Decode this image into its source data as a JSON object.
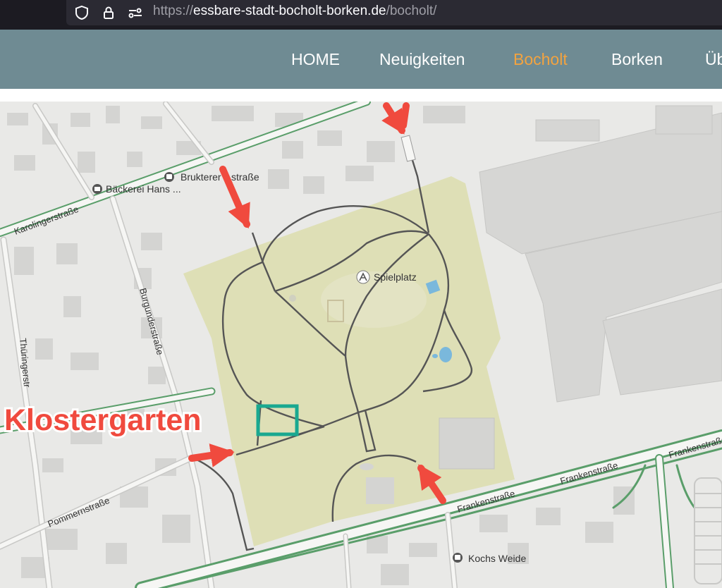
{
  "browser": {
    "url_prefix": "https://",
    "url_domain": "essbare-stadt-bocholt-borken.de",
    "url_path": "/bocholt/",
    "icons": [
      "shield-icon",
      "lock-icon",
      "permissions-icon"
    ]
  },
  "nav": {
    "items": [
      {
        "label": "HOME",
        "active": false
      },
      {
        "label": "Neuigkeiten",
        "active": false
      },
      {
        "label": "Bocholt",
        "active": true
      },
      {
        "label": "Borken",
        "active": false
      },
      {
        "label": "Üb",
        "active": false
      }
    ],
    "background": "#6f8b93",
    "active_color": "#f2a340"
  },
  "map": {
    "streets": {
      "karolingerstrasse": "Karolingerstraße",
      "brukterer": "Brukterer",
      "brukterer_suffix": "straße",
      "burgunderstrasse": "Burgunderstraße",
      "thueringer": "Thüringerstr",
      "pommernstrasse": "Pommernstraße",
      "frankenstrasse": "Frankenstraße"
    },
    "pois": {
      "baeckerei": "Bäckerei Hans ...",
      "spielplatz": "Spielplatz",
      "kochs_weide": "Kochs Weide"
    },
    "annotation": {
      "label": "Klostergarten",
      "color": "#f04a3e",
      "box_color": "#1aa890"
    },
    "colors": {
      "park": "#dedfb6",
      "road_green": "#5a9e6a",
      "path": "#555555",
      "building": "#d4d4d2",
      "water": "#7ab8dc"
    }
  }
}
